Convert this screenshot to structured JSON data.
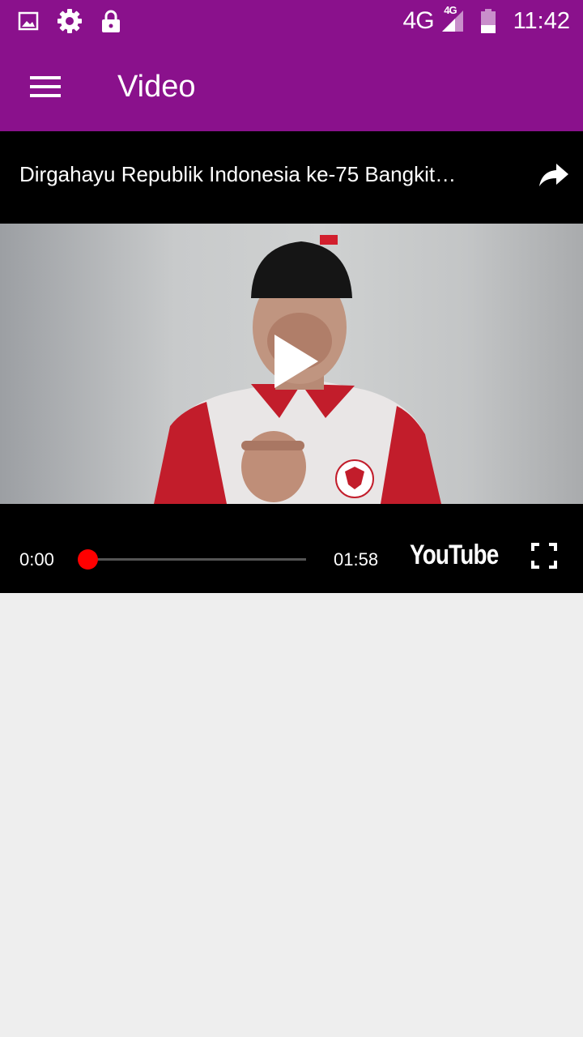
{
  "status_bar": {
    "network": "4G",
    "network_sup": "4G",
    "time": "11:42",
    "icons": [
      "image-icon",
      "gear-icon",
      "lock-icon",
      "signal-icon",
      "battery-icon"
    ]
  },
  "app_bar": {
    "title": "Video",
    "menu_icon": "hamburger-menu-icon"
  },
  "video": {
    "title": "Dirgahayu Republik Indonesia ke-75 Bangkit…",
    "current_time": "0:00",
    "duration": "01:58",
    "progress": 0,
    "brand": "YouTube",
    "share_icon": "share-arrow-icon",
    "fullscreen_icon": "fullscreen-icon",
    "play_icon": "play-icon"
  },
  "colors": {
    "app_bar": "#8a118c",
    "player_bg": "#000000",
    "seek_accent": "#ff0000",
    "page_bg": "#eeeeee"
  }
}
